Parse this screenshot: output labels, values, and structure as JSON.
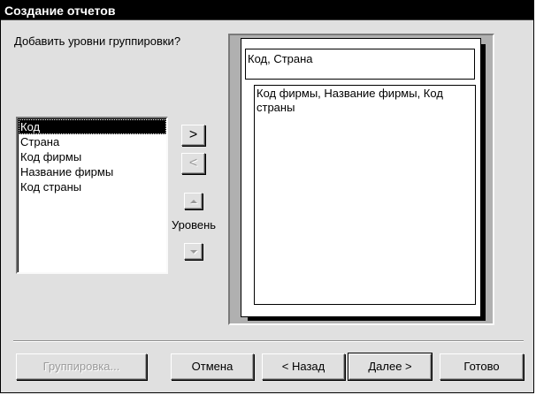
{
  "window": {
    "title": "Создание отчетов"
  },
  "prompt": "Добавить уровни группировки?",
  "fields": {
    "items": [
      "Код",
      "Страна",
      "Код фирмы",
      "Название фирмы",
      "Код страны"
    ],
    "selected_index": 0
  },
  "buttons": {
    "add": ">",
    "remove": "<",
    "level_label": "Уровень"
  },
  "preview": {
    "group_header": "Код, Страна",
    "detail_text": "Код фирмы, Название фирмы, Код страны"
  },
  "footer": {
    "grouping": "Группировка...",
    "cancel": "Отмена",
    "back": "< Назад",
    "next": "Далее >",
    "finish": "Готово"
  }
}
